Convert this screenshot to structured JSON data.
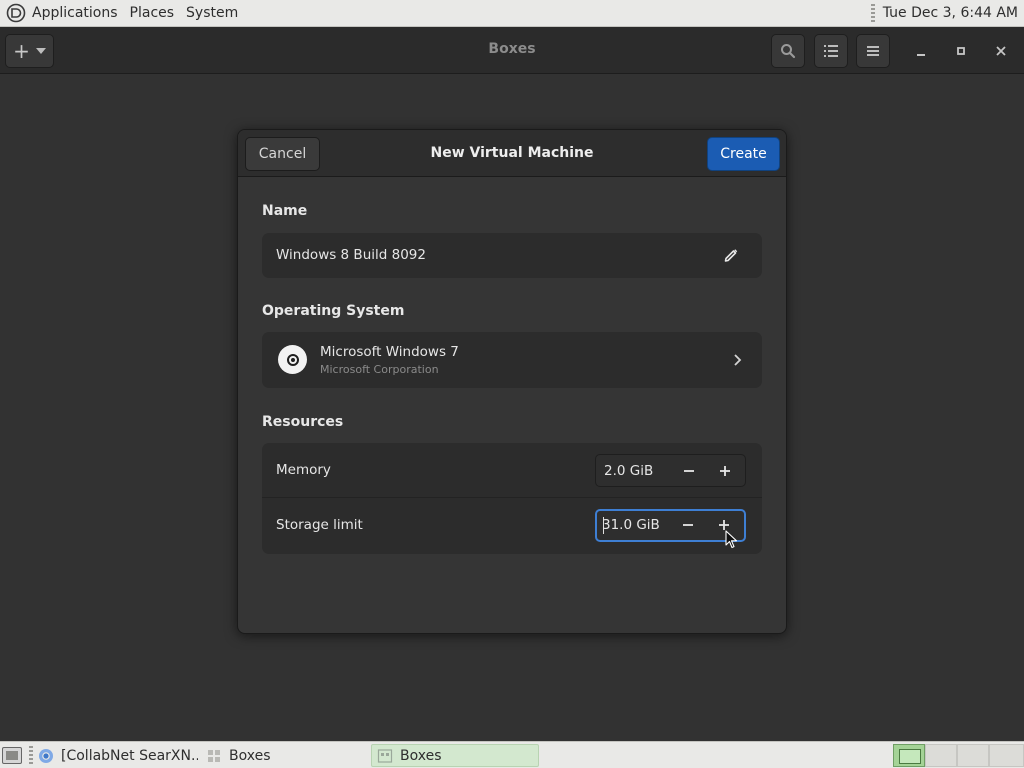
{
  "top_panel": {
    "menus": [
      "Applications",
      "Places",
      "System"
    ],
    "clock": "Tue Dec  3,  6:44 AM"
  },
  "header": {
    "title": "Boxes"
  },
  "dialog": {
    "title": "New Virtual Machine",
    "cancel_label": "Cancel",
    "create_label": "Create",
    "accent_color": "#1b5cb3",
    "name_section": {
      "label": "Name",
      "value": "Windows 8 Build 8092"
    },
    "os_section": {
      "label": "Operating System",
      "os_name": "Microsoft Windows 7",
      "os_vendor": "Microsoft Corporation"
    },
    "resources_section": {
      "label": "Resources",
      "memory": {
        "label": "Memory",
        "value": "2.0 GiB"
      },
      "storage": {
        "label": "Storage limit",
        "value": "31.0 GiB"
      }
    }
  },
  "bottom_panel": {
    "tasks": [
      {
        "label": "[CollabNet SearXN...",
        "icon": "chromium-icon",
        "active": false
      },
      {
        "label": "Boxes",
        "icon": "boxes-icon",
        "active": false
      },
      {
        "label": "Boxes",
        "icon": "boxes-icon",
        "active": true
      }
    ],
    "workspaces": 4,
    "active_workspace": 1
  }
}
